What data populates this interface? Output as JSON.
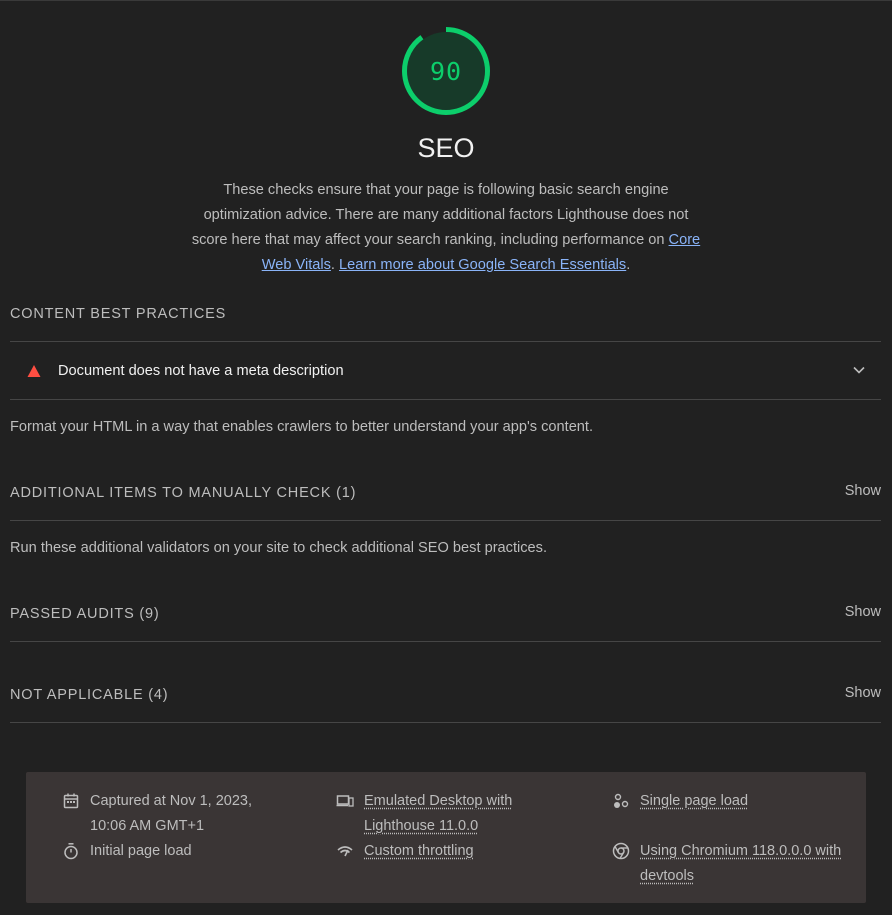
{
  "category": {
    "score": "90",
    "score_fraction": 0.9,
    "title": "SEO",
    "description_text": "These checks ensure that your page is following basic search engine optimization advice. There are many additional factors Lighthouse does not score here that may affect your search ranking, including performance on",
    "link_core_web_vitals": "Core Web Vitals",
    "separator": ".",
    "link_learn_more": "Learn more about Google Search Essentials",
    "end_punct": ".",
    "accent_color": "#0cce6b"
  },
  "groups": {
    "content_best_practices": {
      "title": "CONTENT BEST PRACTICES",
      "audit_title": "Document does not have a meta description",
      "description": "Format your HTML in a way that enables crawlers to better understand your app's content."
    },
    "manual": {
      "title": "ADDITIONAL ITEMS TO MANUALLY CHECK (1)",
      "show": "Show",
      "description": "Run these additional validators on your site to check additional SEO best practices."
    },
    "passed": {
      "title": "PASSED AUDITS (9)",
      "show": "Show"
    },
    "not_applicable": {
      "title": "NOT APPLICABLE (4)",
      "show": "Show"
    }
  },
  "footer": {
    "captured": "Captured at Nov 1, 2023, 10:06 AM GMT+1",
    "initial_load": "Initial page load",
    "emulated": "Emulated Desktop with Lighthouse 11.0.0",
    "throttling": "Custom throttling",
    "single_load": "Single page load",
    "chromium": "Using Chromium 118.0.0.0 with devtools"
  },
  "icons": {
    "fail": "triangle-warning-icon",
    "chevron": "chevron-down-icon",
    "calendar": "calendar-icon",
    "timer": "stopwatch-icon",
    "devices": "devices-icon",
    "network": "network-throttle-icon",
    "single": "single-load-icon",
    "chrome": "chrome-icon"
  }
}
